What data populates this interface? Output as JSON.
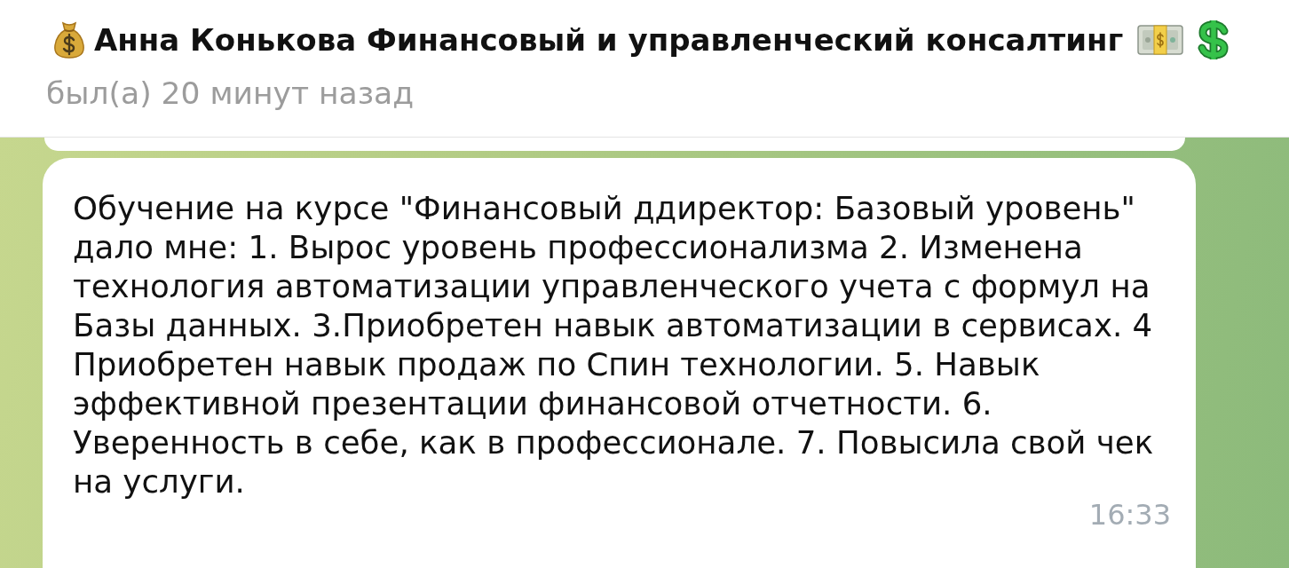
{
  "chat_header": {
    "title": "Анна Конькова Финансовый и управленческий консалтинг",
    "status": "был(а) 20 минут назад"
  },
  "messages": [
    {
      "kind": "cut_off"
    },
    {
      "kind": "text",
      "text": "Обучение на курсе \"Финансовый ддиректор: Базовый уровень\" дало мне: 1. Вырос уровень профессионализма 2. Изменена технология автоматизации управленческого учета с формул на Базы данных. 3.Приобретен навык автоматизации в сервисах. 4 Приобретен навык продаж по Спин технологии. 5. Навык эффективной презентации финансовой отчетности. 6. Уверенность в себе, как в профессионале. 7. Повысила свой чек на услуги.",
      "time": "16:33"
    }
  ]
}
